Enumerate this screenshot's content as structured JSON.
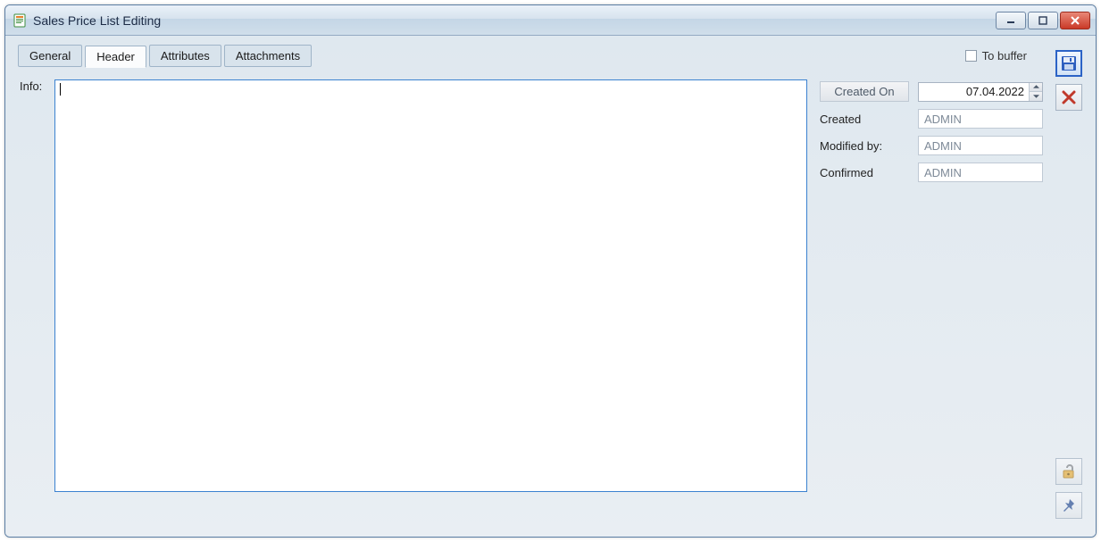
{
  "window": {
    "title": "Sales Price List Editing"
  },
  "tabs": {
    "general": "General",
    "header": "Header",
    "attributes": "Attributes",
    "attachments": "Attachments",
    "active": "header"
  },
  "to_buffer": {
    "label": "To buffer",
    "checked": false
  },
  "info": {
    "label": "Info:",
    "value": ""
  },
  "meta": {
    "created_on_btn": "Created On",
    "created_on_value": "07.04.2022",
    "created_label": "Created",
    "created_value": "ADMIN",
    "modified_label": "Modified by:",
    "modified_value": "ADMIN",
    "confirmed_label": "Confirmed",
    "confirmed_value": "ADMIN"
  },
  "icons": {
    "app": "price-list-icon",
    "save": "save-icon",
    "delete": "delete-icon",
    "unlock": "unlock-icon",
    "pin": "pin-icon",
    "minimize": "minimize-icon",
    "maximize": "maximize-icon",
    "close": "close-icon"
  }
}
